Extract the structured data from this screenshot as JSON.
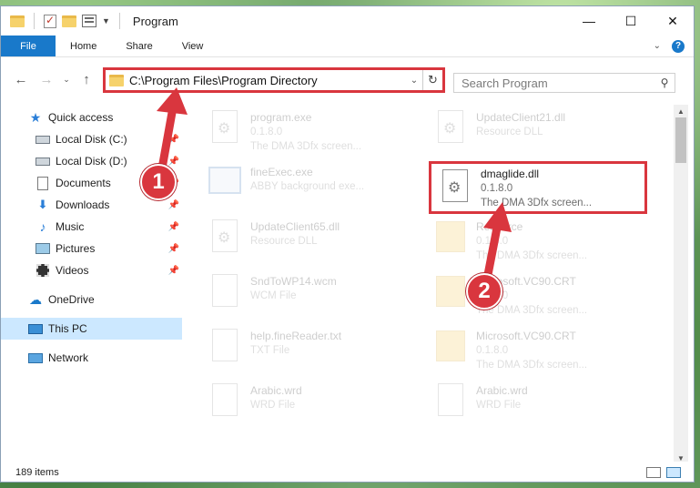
{
  "window": {
    "title": "Program",
    "controls": {
      "minimize": "—",
      "maximize": "☐",
      "close": "✕"
    }
  },
  "ribbon": {
    "tabs": [
      {
        "label": "File"
      },
      {
        "label": "Home"
      },
      {
        "label": "Share"
      },
      {
        "label": "View"
      }
    ]
  },
  "nav": {
    "address": "C:\\Program Files\\Program Directory",
    "search_placeholder": "Search Program"
  },
  "sidebar": {
    "items": [
      {
        "label": "Quick access",
        "icon": "star-icon"
      },
      {
        "label": "Local Disk (C:)",
        "icon": "drive-icon",
        "pinned": true
      },
      {
        "label": "Local Disk (D:)",
        "icon": "drive-icon",
        "pinned": true
      },
      {
        "label": "Documents",
        "icon": "documents-icon",
        "pinned": true
      },
      {
        "label": "Downloads",
        "icon": "downloads-icon",
        "pinned": true
      },
      {
        "label": "Music",
        "icon": "music-icon",
        "pinned": true
      },
      {
        "label": "Pictures",
        "icon": "pictures-icon",
        "pinned": true
      },
      {
        "label": "Videos",
        "icon": "videos-icon",
        "pinned": true
      },
      {
        "label": "OneDrive",
        "icon": "onedrive-icon"
      },
      {
        "label": "This PC",
        "icon": "this-pc-icon",
        "selected": true
      },
      {
        "label": "Network",
        "icon": "network-icon"
      }
    ]
  },
  "files": [
    {
      "name": "program.exe",
      "line1": "0.1.8.0",
      "line2": "The DMA 3Dfx screen...",
      "icon": "gear-file-icon",
      "faded": true
    },
    {
      "name": "UpdateClient21.dll",
      "line1": "Resource DLL",
      "line2": "",
      "icon": "gear-file-icon",
      "faded": true
    },
    {
      "name": "fineExec.exe",
      "line1": "ABBY background exe...",
      "line2": "",
      "icon": "app-icon",
      "faded": true
    },
    {
      "name": "dmaglide.dll",
      "line1": "0.1.8.0",
      "line2": "The DMA 3Dfx screen...",
      "icon": "gear-file-icon",
      "faded": false
    },
    {
      "name": "UpdateClient65.dll",
      "line1": "Resource DLL",
      "line2": "",
      "icon": "gear-file-icon",
      "faded": true
    },
    {
      "name": "Resource",
      "line1": "0.1.8.0",
      "line2": "The DMA 3Dfx screen...",
      "icon": "folder-file-icon",
      "faded": true
    },
    {
      "name": "SndToWP14.wcm",
      "line1": "WCM File",
      "line2": "",
      "icon": "blank-file-icon",
      "faded": true
    },
    {
      "name": "Microsoft.VC90.CRT",
      "line1": "0.1.8.0",
      "line2": "The DMA 3Dfx screen...",
      "icon": "folder-file-icon",
      "faded": true
    },
    {
      "name": "help.fineReader.txt",
      "line1": "TXT File",
      "line2": "",
      "icon": "blank-file-icon",
      "faded": true
    },
    {
      "name": "Microsoft.VC90.CRT",
      "line1": "0.1.8.0",
      "line2": "The DMA 3Dfx screen...",
      "icon": "folder-file-icon",
      "faded": true
    },
    {
      "name": "Arabic.wrd",
      "line1": "WRD File",
      "line2": "",
      "icon": "blank-file-icon",
      "faded": true
    },
    {
      "name": "Arabic.wrd",
      "line1": "WRD File",
      "line2": "",
      "icon": "blank-file-icon",
      "faded": true
    }
  ],
  "status": {
    "count": "189 items"
  },
  "callouts": [
    {
      "label": "1"
    },
    {
      "label": "2"
    }
  ],
  "colors": {
    "accent": "#1979ca",
    "highlight": "#d9363e",
    "selected": "#cce8ff"
  }
}
